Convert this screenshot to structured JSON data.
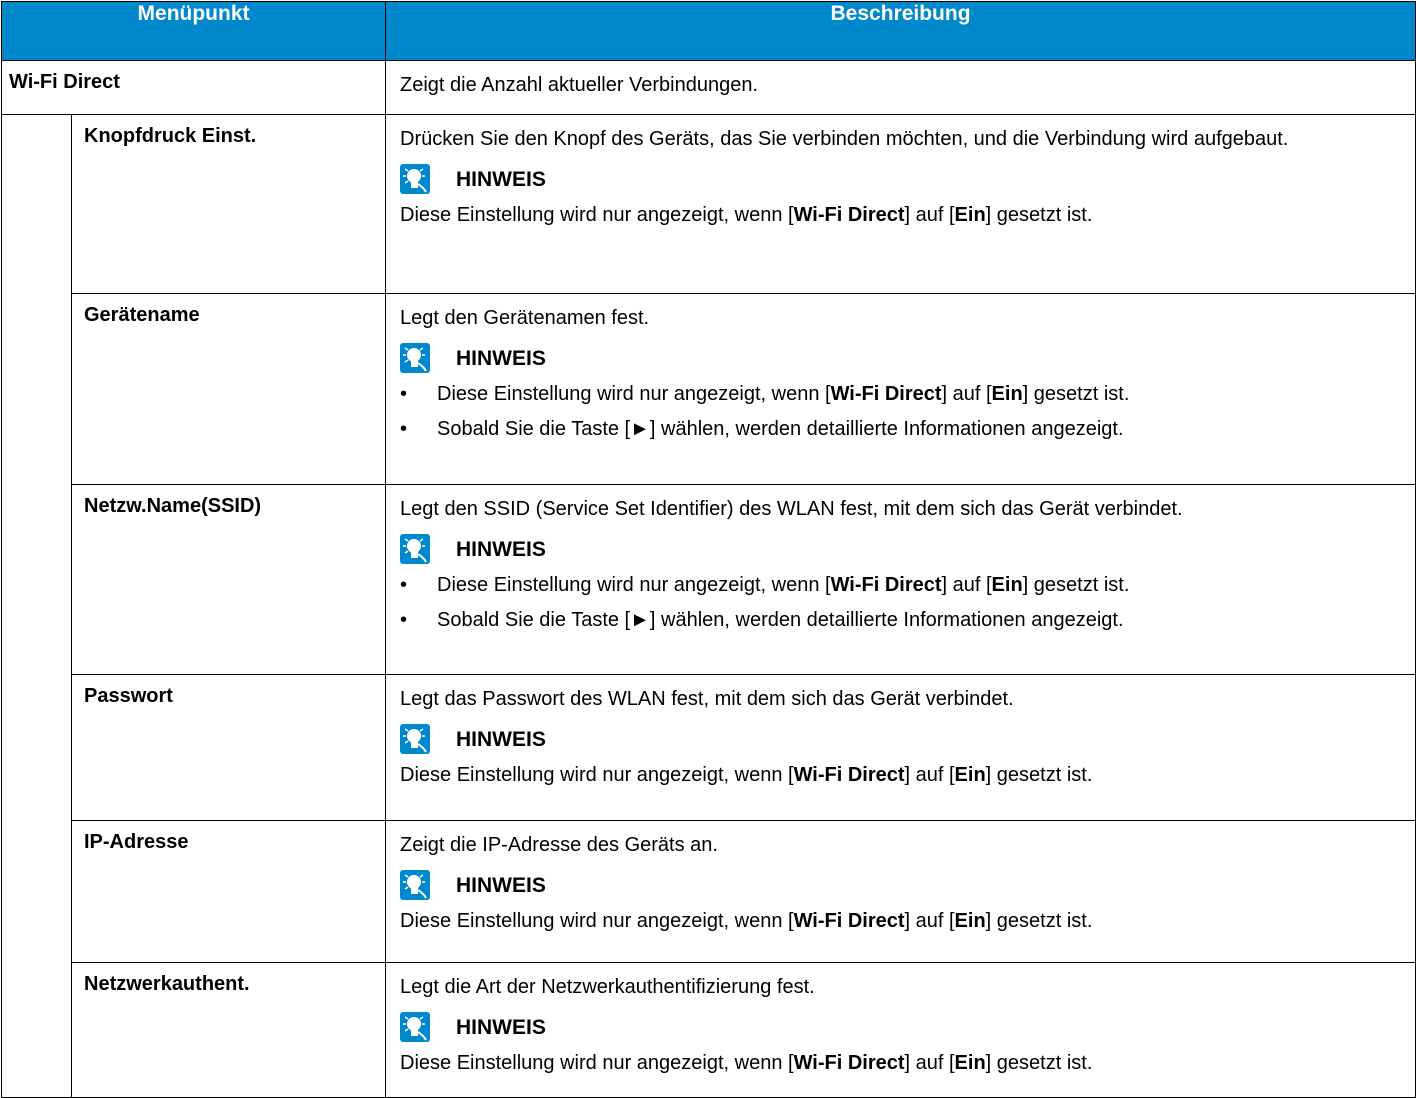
{
  "header": {
    "col_menu": "Menüpunkt",
    "col_desc": "Beschreibung"
  },
  "icon": {
    "name": "hint-lightbulb-icon",
    "color": "#0088cc"
  },
  "rows": [
    {
      "label": "Wi-Fi Direct",
      "desc": "Zeigt die Anzahl aktueller Verbindungen."
    },
    {
      "label": "Knopfdruck Einst.",
      "desc": "Drücken Sie den Knopf des Geräts, das Sie verbinden möchten, und die Verbindung wird aufgebaut.",
      "note_title": "HINWEIS",
      "note": {
        "a": "Diese Einstellung wird nur angezeigt, wenn [",
        "b": "Wi-Fi Direct",
        "c": "] auf [",
        "d": "Ein",
        "e": "] gesetzt ist."
      }
    },
    {
      "label": "Gerätename",
      "desc": "Legt den Gerätenamen fest.",
      "note_title": "HINWEIS",
      "bullet": "•",
      "note": {
        "a": "Diese Einstellung wird nur angezeigt, wenn [",
        "b": "Wi-Fi Direct",
        "c": "] auf [",
        "d": "Ein",
        "e": "] gesetzt ist."
      },
      "note2": "Sobald Sie die Taste [►] wählen, werden detaillierte Informationen angezeigt."
    },
    {
      "label": "Netzw.Name(SSID)",
      "desc": "Legt den SSID (Service Set Identifier) des WLAN fest, mit dem sich das Gerät verbindet.",
      "note_title": "HINWEIS",
      "bullet": "•",
      "note": {
        "a": "Diese Einstellung wird nur angezeigt, wenn [",
        "b": "Wi-Fi Direct",
        "c": "] auf [",
        "d": "Ein",
        "e": "] gesetzt ist."
      },
      "note2": "Sobald Sie die Taste [►] wählen, werden detaillierte Informationen angezeigt."
    },
    {
      "label": "Passwort",
      "desc": "Legt das Passwort des WLAN fest, mit dem sich das Gerät verbindet.",
      "note_title": "HINWEIS",
      "note": {
        "a": "Diese Einstellung wird nur angezeigt, wenn [",
        "b": "Wi-Fi Direct",
        "c": "] auf [",
        "d": "Ein",
        "e": "] gesetzt ist."
      }
    },
    {
      "label": "IP-Adresse",
      "desc": "Zeigt die IP-Adresse des Geräts an.",
      "note_title": "HINWEIS",
      "note": {
        "a": "Diese Einstellung wird nur angezeigt, wenn [",
        "b": "Wi-Fi Direct",
        "c": "] auf [",
        "d": "Ein",
        "e": "] gesetzt ist."
      }
    },
    {
      "label": "Netzwerkauthent.",
      "desc": "Legt die Art der Netzwerkauthentifizierung fest.",
      "note_title": "HINWEIS",
      "note": {
        "a": "Diese Einstellung wird nur angezeigt, wenn [",
        "b": "Wi-Fi Direct",
        "c": "] auf [",
        "d": "Ein",
        "e": "] gesetzt ist."
      }
    }
  ]
}
